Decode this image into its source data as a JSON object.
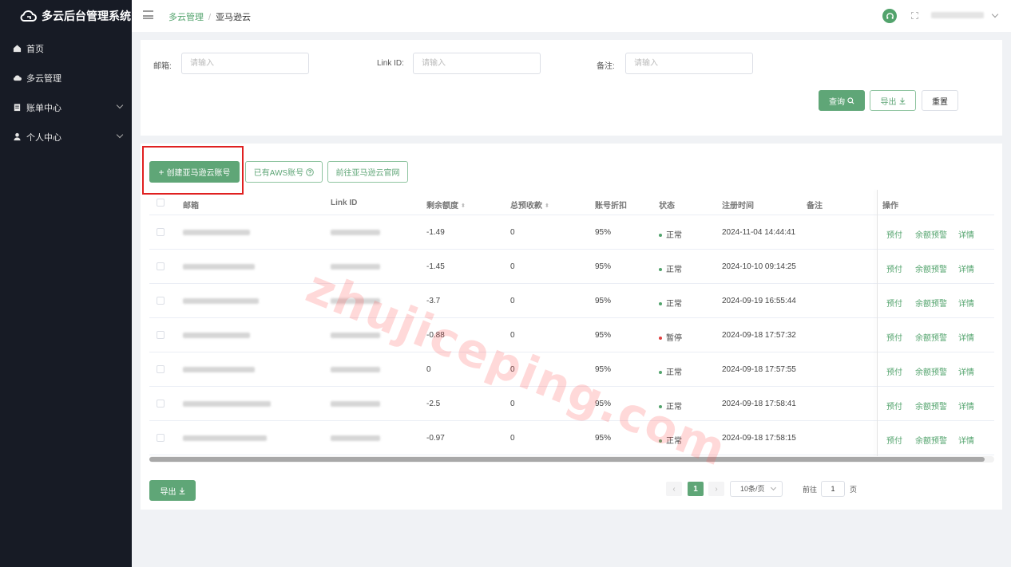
{
  "app": {
    "title": "多云后台管理系统"
  },
  "sidebar": {
    "items": [
      {
        "label": "首页",
        "icon": "home-icon"
      },
      {
        "label": "多云管理",
        "icon": "cloud-icon"
      },
      {
        "label": "账单中心",
        "icon": "bill-icon",
        "expandable": true
      },
      {
        "label": "个人中心",
        "icon": "user-icon",
        "expandable": true
      }
    ]
  },
  "breadcrumb": {
    "parent": "多云管理",
    "separator": "/",
    "current": "亚马逊云"
  },
  "filters": {
    "email_label": "邮箱:",
    "email_placeholder": "请输入",
    "linkid_label": "Link ID:",
    "linkid_placeholder": "请输入",
    "note_label": "备注:",
    "note_placeholder": "请输入",
    "query_label": "查询",
    "export_label": "导出",
    "reset_label": "重置"
  },
  "actions": {
    "create_label": "创建亚马逊云账号",
    "has_aws_label": "已有AWS账号",
    "goto_official_label": "前往亚马逊云官网"
  },
  "table": {
    "columns": {
      "email": "邮箱",
      "link_id": "Link ID",
      "remaining": "剩余额度",
      "prepaid": "总预收款",
      "discount": "账号折扣",
      "status": "状态",
      "registered": "注册时间",
      "note": "备注",
      "ops": "操作"
    },
    "op_labels": {
      "prepay": "预付",
      "alert": "余额预警",
      "detail": "详情"
    },
    "rows": [
      {
        "remaining": "-1.49",
        "prepaid": "0",
        "discount": "95%",
        "status": "正常",
        "status_color": "#52a36c",
        "registered": "2024-11-04 14:44:41"
      },
      {
        "remaining": "-1.45",
        "prepaid": "0",
        "discount": "95%",
        "status": "正常",
        "status_color": "#52a36c",
        "registered": "2024-10-10 09:14:25"
      },
      {
        "remaining": "-3.7",
        "prepaid": "0",
        "discount": "95%",
        "status": "正常",
        "status_color": "#52a36c",
        "registered": "2024-09-19 16:55:44"
      },
      {
        "remaining": "-0.88",
        "prepaid": "0",
        "discount": "95%",
        "status": "暂停",
        "status_color": "#e04040",
        "registered": "2024-09-18 17:57:32"
      },
      {
        "remaining": "0",
        "prepaid": "0",
        "discount": "95%",
        "status": "正常",
        "status_color": "#52a36c",
        "registered": "2024-09-18 17:57:55"
      },
      {
        "remaining": "-2.5",
        "prepaid": "0",
        "discount": "95%",
        "status": "正常",
        "status_color": "#52a36c",
        "registered": "2024-09-18 17:58:41"
      },
      {
        "remaining": "-0.97",
        "prepaid": "0",
        "discount": "95%",
        "status": "正常",
        "status_color": "#52a36c",
        "registered": "2024-09-18 17:58:15"
      }
    ]
  },
  "footer": {
    "export_label": "导出",
    "current_page": "1",
    "page_size": "10条/页",
    "goto_prefix": "前往",
    "goto_value": "1",
    "goto_suffix": "页"
  },
  "watermark": {
    "text": "zhujiceping.com"
  },
  "colors": {
    "accent": "#52a36c",
    "sidebar_bg": "#171b25",
    "highlight": "#e02020"
  }
}
